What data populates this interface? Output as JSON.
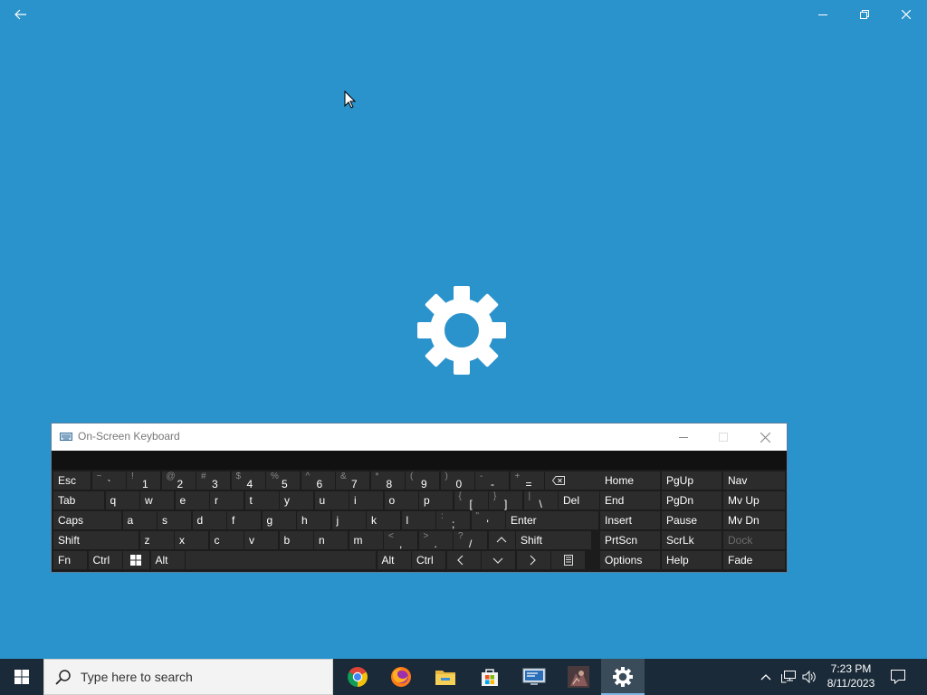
{
  "app": {
    "window_icons": [
      "back-icon",
      "minimize-icon",
      "restore-icon",
      "close-icon"
    ],
    "center_icon": "gear-icon",
    "background_color": "#2b93cc"
  },
  "osk": {
    "title": "On-Screen Keyboard",
    "rows": [
      [
        {
          "name": "esc",
          "label": "Esc",
          "w": 41
        },
        {
          "name": "tilde",
          "shift": "~",
          "lo": "`",
          "w": 37
        },
        {
          "name": "1",
          "shift": "!",
          "lo": "1",
          "w": 37
        },
        {
          "name": "2",
          "shift": "@",
          "lo": "2",
          "w": 37
        },
        {
          "name": "3",
          "shift": "#",
          "lo": "3",
          "w": 37
        },
        {
          "name": "4",
          "shift": "$",
          "lo": "4",
          "w": 37
        },
        {
          "name": "5",
          "shift": "%",
          "lo": "5",
          "w": 37
        },
        {
          "name": "6",
          "shift": "^",
          "lo": "6",
          "w": 37
        },
        {
          "name": "7",
          "shift": "&",
          "lo": "7",
          "w": 37
        },
        {
          "name": "8",
          "shift": "*",
          "lo": "8",
          "w": 37
        },
        {
          "name": "9",
          "shift": "(",
          "lo": "9",
          "w": 37
        },
        {
          "name": "0",
          "shift": ")",
          "lo": "0",
          "w": 37
        },
        {
          "name": "minus",
          "shift": "-",
          "lo": "-",
          "w": 37
        },
        {
          "name": "equals",
          "shift": "+",
          "lo": "=",
          "w": 37
        },
        {
          "name": "backspace",
          "icon": "backspace",
          "w": 64
        }
      ],
      [
        {
          "name": "tab",
          "label": "Tab",
          "w": 56
        },
        {
          "name": "q",
          "label": "q",
          "w": 37
        },
        {
          "name": "w",
          "label": "w",
          "w": 37
        },
        {
          "name": "e",
          "label": "e",
          "w": 37
        },
        {
          "name": "r",
          "label": "r",
          "w": 37
        },
        {
          "name": "t",
          "label": "t",
          "w": 37
        },
        {
          "name": "y",
          "label": "y",
          "w": 37
        },
        {
          "name": "u",
          "label": "u",
          "w": 37
        },
        {
          "name": "i",
          "label": "i",
          "w": 37
        },
        {
          "name": "o",
          "label": "o",
          "w": 37
        },
        {
          "name": "p",
          "label": "p",
          "w": 37
        },
        {
          "name": "lbracket",
          "shift": "{",
          "lo": "[",
          "w": 37
        },
        {
          "name": "rbracket",
          "shift": "}",
          "lo": "]",
          "w": 37
        },
        {
          "name": "backslash",
          "shift": "|",
          "lo": "\\",
          "w": 37
        },
        {
          "name": "del",
          "label": "Del",
          "w": 45
        }
      ],
      [
        {
          "name": "caps",
          "label": "Caps",
          "w": 75
        },
        {
          "name": "a",
          "label": "a",
          "w": 37
        },
        {
          "name": "s",
          "label": "s",
          "w": 37
        },
        {
          "name": "d",
          "label": "d",
          "w": 37
        },
        {
          "name": "f",
          "label": "f",
          "w": 37
        },
        {
          "name": "g",
          "label": "g",
          "w": 37
        },
        {
          "name": "h",
          "label": "h",
          "w": 37
        },
        {
          "name": "j",
          "label": "j",
          "w": 37
        },
        {
          "name": "k",
          "label": "k",
          "w": 37
        },
        {
          "name": "l",
          "label": "l",
          "w": 37
        },
        {
          "name": "semicolon",
          "shift": ":",
          "lo": ";",
          "w": 37
        },
        {
          "name": "quote",
          "shift": "\"",
          "lo": "'",
          "w": 37
        },
        {
          "name": "enter",
          "label": "Enter",
          "w": 102
        }
      ],
      [
        {
          "name": "shift-left",
          "label": "Shift",
          "w": 94
        },
        {
          "name": "z",
          "label": "z",
          "w": 37
        },
        {
          "name": "x",
          "label": "x",
          "w": 37
        },
        {
          "name": "c",
          "label": "c",
          "w": 37
        },
        {
          "name": "v",
          "label": "v",
          "w": 37
        },
        {
          "name": "b",
          "label": "b",
          "w": 37
        },
        {
          "name": "n",
          "label": "n",
          "w": 37
        },
        {
          "name": "m",
          "label": "m",
          "w": 37
        },
        {
          "name": "comma",
          "shift": "<",
          "lo": ",",
          "w": 37
        },
        {
          "name": "period",
          "shift": ">",
          "lo": ".",
          "w": 37
        },
        {
          "name": "slash",
          "shift": "?",
          "lo": "/",
          "w": 37
        },
        {
          "name": "up",
          "icon": "up",
          "w": 29
        },
        {
          "name": "shift-right",
          "label": "Shift",
          "w": 83
        }
      ],
      [
        {
          "name": "fn",
          "label": "Fn",
          "w": 37
        },
        {
          "name": "ctrl-left",
          "label": "Ctrl",
          "w": 37
        },
        {
          "name": "win",
          "icon": "win",
          "w": 29
        },
        {
          "name": "alt-left",
          "label": "Alt",
          "w": 37
        },
        {
          "name": "space",
          "label": "",
          "w": 210
        },
        {
          "name": "alt-right",
          "label": "Alt",
          "w": 37
        },
        {
          "name": "ctrl-right",
          "label": "Ctrl",
          "w": 37
        },
        {
          "name": "left",
          "icon": "left",
          "w": 37
        },
        {
          "name": "down",
          "icon": "down",
          "w": 37
        },
        {
          "name": "right",
          "icon": "right",
          "w": 37
        },
        {
          "name": "menu",
          "icon": "menu",
          "w": 37
        }
      ]
    ],
    "nav_rows": [
      [
        {
          "name": "home",
          "label": "Home"
        },
        {
          "name": "pgup",
          "label": "PgUp"
        },
        {
          "name": "nav",
          "label": "Nav"
        }
      ],
      [
        {
          "name": "end",
          "label": "End"
        },
        {
          "name": "pgdn",
          "label": "PgDn"
        },
        {
          "name": "mvup",
          "label": "Mv Up"
        }
      ],
      [
        {
          "name": "insert",
          "label": "Insert"
        },
        {
          "name": "pause",
          "label": "Pause"
        },
        {
          "name": "mvdn",
          "label": "Mv Dn"
        }
      ],
      [
        {
          "name": "prtscn",
          "label": "PrtScn"
        },
        {
          "name": "scrlk",
          "label": "ScrLk"
        },
        {
          "name": "dock",
          "label": "Dock",
          "dim": true
        }
      ],
      [
        {
          "name": "options",
          "label": "Options"
        },
        {
          "name": "help",
          "label": "Help"
        },
        {
          "name": "fade",
          "label": "Fade"
        }
      ]
    ]
  },
  "taskbar": {
    "search_placeholder": "Type here to search",
    "apps": [
      "chrome-icon",
      "firefox-icon",
      "file-explorer-icon",
      "microsoft-store-icon",
      "remote-desktop-icon",
      "game-icon",
      "settings-icon"
    ],
    "time": "7:23 PM",
    "date": "8/11/2023"
  }
}
